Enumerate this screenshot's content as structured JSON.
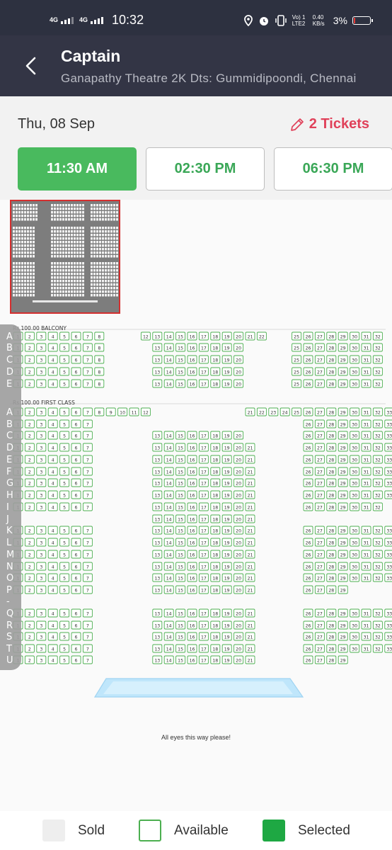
{
  "status_bar": {
    "net1": "4G",
    "net2": "4G",
    "time": "10:32",
    "volte": "Vo) 1 LTE2",
    "speed": "0.40 KB/s",
    "battery": "3%"
  },
  "header": {
    "title": "Captain",
    "subtitle": "Ganapathy Theatre 2K Dts: Gummidipoondi, Chennai"
  },
  "booking": {
    "date": "Thu, 08 Sep",
    "tickets": "2 Tickets",
    "showtimes": [
      {
        "label": "11:30 AM",
        "active": true
      },
      {
        "label": "02:30 PM",
        "active": false
      },
      {
        "label": "06:30 PM",
        "active": false
      }
    ]
  },
  "seat_map": {
    "balcony_label": "Rs.100.00  BALCONY",
    "first_class_label": "Rs.100.00  FIRST CLASS",
    "balcony_rows": [
      "A",
      "B",
      "C",
      "D",
      "E"
    ],
    "first_class_rows": [
      "A",
      "B",
      "C",
      "D",
      "E",
      "F",
      "G",
      "H",
      "I",
      "J",
      "K",
      "L",
      "M",
      "N",
      "O",
      "P",
      "-",
      "Q",
      "R",
      "S",
      "T",
      "U"
    ],
    "screen_text": "All eyes this way please!"
  },
  "legend": {
    "sold": "Sold",
    "available": "Available",
    "selected": "Selected"
  },
  "colors": {
    "accent_green": "#49ba5e",
    "ticket_red": "#e0415a",
    "header_bg": "#333545",
    "seat_border": "#4caf50"
  }
}
